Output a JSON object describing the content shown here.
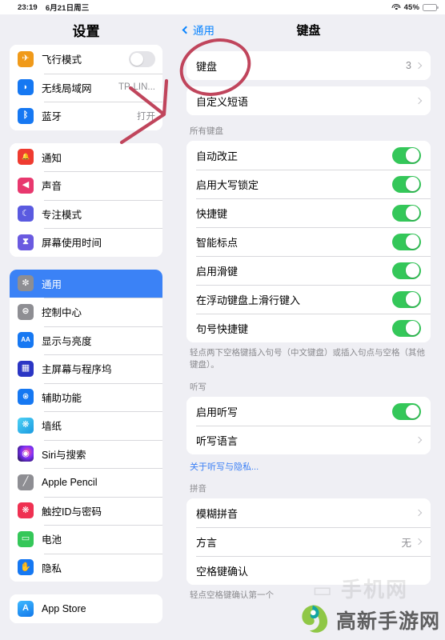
{
  "statusbar": {
    "time": "23:19",
    "date": "6月21日周三",
    "wifi_icon": "wifi-icon",
    "battery_percent": "45%",
    "battery_level": 45,
    "battery_color": "#f7c948"
  },
  "sidebar": {
    "title": "设置",
    "groups": [
      {
        "items": [
          {
            "label": "飞行模式",
            "icon": "airplane-icon",
            "icon_color": "#f09a1a",
            "control": "toggle",
            "toggle_on": false
          },
          {
            "label": "无线局域网",
            "icon": "wifi-icon",
            "icon_color": "#1678f2",
            "control": "value",
            "value": "TP-LIN..."
          },
          {
            "label": "蓝牙",
            "icon": "bluetooth-icon",
            "icon_color": "#1678f2",
            "control": "value",
            "value": "打开"
          }
        ]
      },
      {
        "items": [
          {
            "label": "通知",
            "icon": "bell-icon",
            "icon_color": "#ef3b30",
            "control": "none"
          },
          {
            "label": "声音",
            "icon": "speaker-icon",
            "icon_color": "#e8386e",
            "control": "none"
          },
          {
            "label": "专注模式",
            "icon": "moon-icon",
            "icon_color": "#5a5ae0",
            "control": "none"
          },
          {
            "label": "屏幕使用时间",
            "icon": "hourglass-icon",
            "icon_color": "#6a5ae0",
            "control": "none"
          }
        ]
      },
      {
        "items": [
          {
            "label": "通用",
            "icon": "gear-icon",
            "icon_color": "#8e8e93",
            "control": "none",
            "selected": true
          },
          {
            "label": "控制中心",
            "icon": "sliders-icon",
            "icon_color": "#8e8e93",
            "control": "none"
          },
          {
            "label": "显示与亮度",
            "icon": "aa-icon",
            "icon_color": "#1678f2",
            "control": "none"
          },
          {
            "label": "主屏幕与程序坞",
            "icon": "home-grid-icon",
            "icon_color": "#2b36c4",
            "control": "none"
          },
          {
            "label": "辅助功能",
            "icon": "accessibility-icon",
            "icon_color": "#1678f2",
            "control": "none"
          },
          {
            "label": "墙纸",
            "icon": "wallpaper-icon",
            "icon_color": "#3ec6f0",
            "control": "none"
          },
          {
            "label": "Siri与搜索",
            "icon": "siri-icon",
            "icon_color": "#2a1c40",
            "control": "none"
          },
          {
            "label": "Apple Pencil",
            "icon": "pencil-icon",
            "icon_color": "#8e8e93",
            "control": "none"
          },
          {
            "label": "触控ID与密码",
            "icon": "touchid-icon",
            "icon_color": "#ef3152",
            "control": "none"
          },
          {
            "label": "电池",
            "icon": "battery-icon",
            "icon_color": "#35c759",
            "control": "none"
          },
          {
            "label": "隐私",
            "icon": "hand-icon",
            "icon_color": "#1678f2",
            "control": "none"
          }
        ]
      },
      {
        "items": [
          {
            "label": "App Store",
            "icon": "appstore-icon",
            "icon_color": "#1a9cf0",
            "control": "none"
          }
        ]
      }
    ]
  },
  "detail": {
    "back_label": "通用",
    "title": "键盘",
    "sections": [
      {
        "header": "",
        "rows": [
          {
            "label": "键盘",
            "value": "3",
            "chevron": true
          }
        ],
        "footer": ""
      },
      {
        "header": "",
        "rows": [
          {
            "label": "自定义短语",
            "value": "",
            "chevron": true
          }
        ],
        "footer": ""
      },
      {
        "header": "所有键盘",
        "rows": [
          {
            "label": "自动改正",
            "control": "toggle",
            "toggle_on": true
          },
          {
            "label": "启用大写锁定",
            "control": "toggle",
            "toggle_on": true
          },
          {
            "label": "快捷键",
            "control": "toggle",
            "toggle_on": true
          },
          {
            "label": "智能标点",
            "control": "toggle",
            "toggle_on": true
          },
          {
            "label": "启用滑键",
            "control": "toggle",
            "toggle_on": true
          },
          {
            "label": "在浮动键盘上滑行键入",
            "control": "toggle",
            "toggle_on": true
          },
          {
            "label": "句号快捷键",
            "control": "toggle",
            "toggle_on": true
          }
        ],
        "footer": "轻点两下空格键插入句号（中文键盘）或插入句点与空格（其他键盘）。"
      },
      {
        "header": "听写",
        "rows": [
          {
            "label": "启用听写",
            "control": "toggle",
            "toggle_on": true
          },
          {
            "label": "听写语言",
            "value": "",
            "chevron": true
          }
        ],
        "footer": "",
        "link": "关于听写与隐私..."
      },
      {
        "header": "拼音",
        "rows": [
          {
            "label": "模糊拼音",
            "value": "",
            "chevron": true
          },
          {
            "label": "方言",
            "value": "无",
            "chevron": true
          },
          {
            "label": "空格键确认",
            "value": "",
            "chevron": false
          }
        ],
        "footer": "轻点空格键确认第一个"
      }
    ]
  },
  "annotations": {
    "circle_target": "键盘",
    "arrow_target": "无线局域网",
    "ink_color": "#c0455c"
  },
  "watermark": {
    "text": "高新手游网",
    "logo_colors": [
      "#8cc63f",
      "#0aa3a0"
    ]
  }
}
